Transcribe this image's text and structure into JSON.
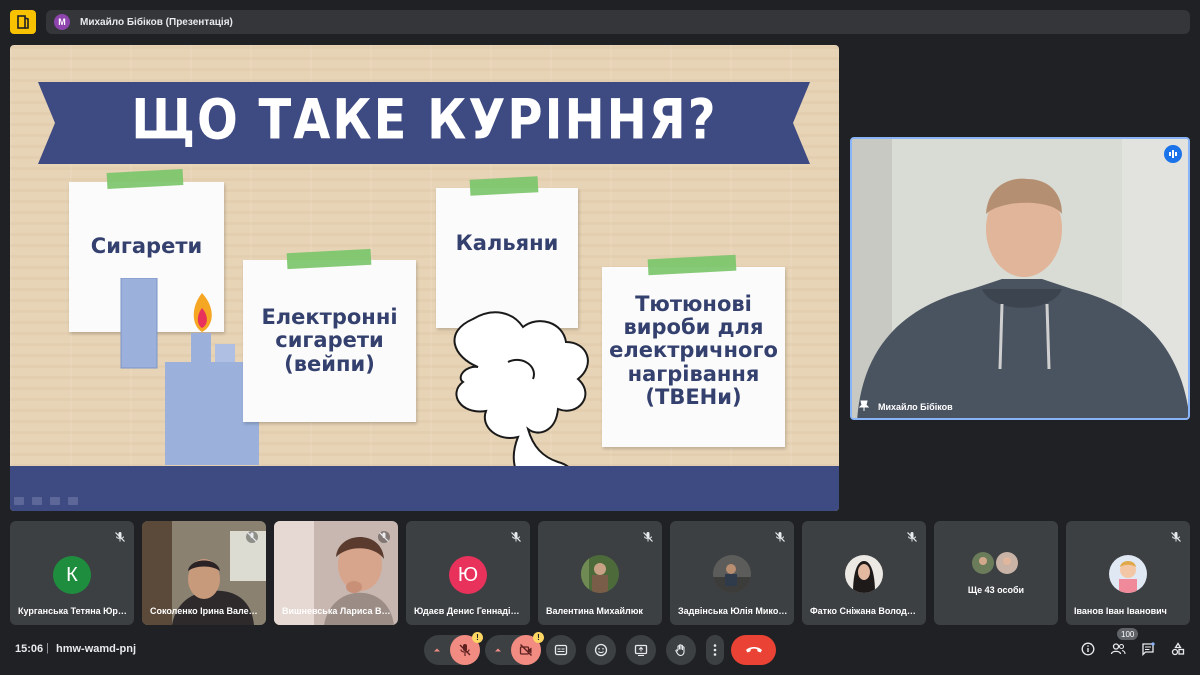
{
  "window": {
    "presenter_initial": "М",
    "title": "Михайло Бібіков (Презентація)"
  },
  "slide": {
    "title": "ЩО ТАКЕ КУРІННЯ?",
    "cards": [
      "Сигарети",
      "Електронні сигарети (вейпи)",
      "Кальяни",
      "Тютюнові вироби для електричного нагрівання (ТВЕНи)"
    ]
  },
  "speaker": {
    "name": "Михайло Бібіков"
  },
  "participants": [
    {
      "name": "Курганська Тетяна Юр…",
      "initial": "К",
      "color": "#1e8e3e",
      "type": "letter"
    },
    {
      "name": "Соколенко Ірина Вале…",
      "type": "video"
    },
    {
      "name": "Вишневська Лариса В…",
      "type": "video"
    },
    {
      "name": "Юдаєв Денис Геннаді…",
      "initial": "Ю",
      "color": "#e8315b",
      "type": "letter"
    },
    {
      "name": "Валентина Михайлюк",
      "type": "photo"
    },
    {
      "name": "Задвінська Юлія Мико…",
      "type": "photo"
    },
    {
      "name": "Фатко Сніжана Волод…",
      "type": "photo"
    },
    {
      "name": "Ще 43 особи",
      "type": "more"
    },
    {
      "name": "Іванов Іван Іванович",
      "type": "photo"
    }
  ],
  "bottom_bar": {
    "time": "15:06",
    "separator": "|",
    "meeting_code": "hmw-wamd-pnj",
    "participants_count": "100"
  },
  "colors": {
    "hangup": "#ea4335",
    "muted_warning": "#f28b82",
    "slide_blue": "#3e4a82"
  }
}
